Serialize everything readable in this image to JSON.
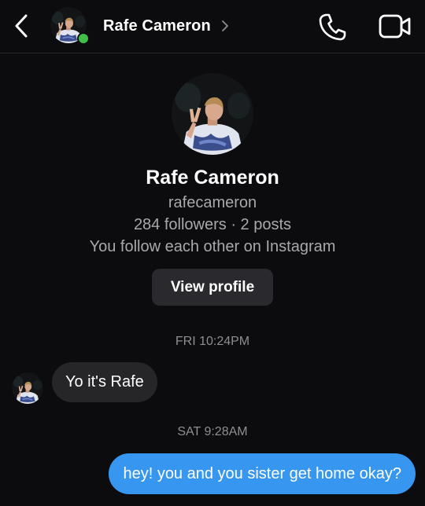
{
  "header": {
    "contact_name": "Rafe Cameron",
    "online": true
  },
  "profile": {
    "name": "Rafe Cameron",
    "username": "rafecameron",
    "stats": "284 followers · 2 posts",
    "mutual": "You follow each other on Instagram",
    "view_profile_label": "View profile"
  },
  "messages": [
    {
      "timestamp": "FRI 10:24PM",
      "direction": "incoming",
      "text": "Yo it's Rafe"
    },
    {
      "timestamp": "SAT 9:28AM",
      "direction": "outgoing",
      "text": "hey! you and you sister get home okay?"
    }
  ],
  "icons": {
    "back": "chevron-left-icon",
    "profile_link": "chevron-right-icon",
    "call": "phone-icon",
    "video": "video-camera-icon"
  },
  "colors": {
    "background": "#0c0c0f",
    "incoming_bubble": "#262629",
    "outgoing_bubble": "#3797f0",
    "online_indicator": "#3fbf4a",
    "secondary_text": "#a8a8ad"
  }
}
